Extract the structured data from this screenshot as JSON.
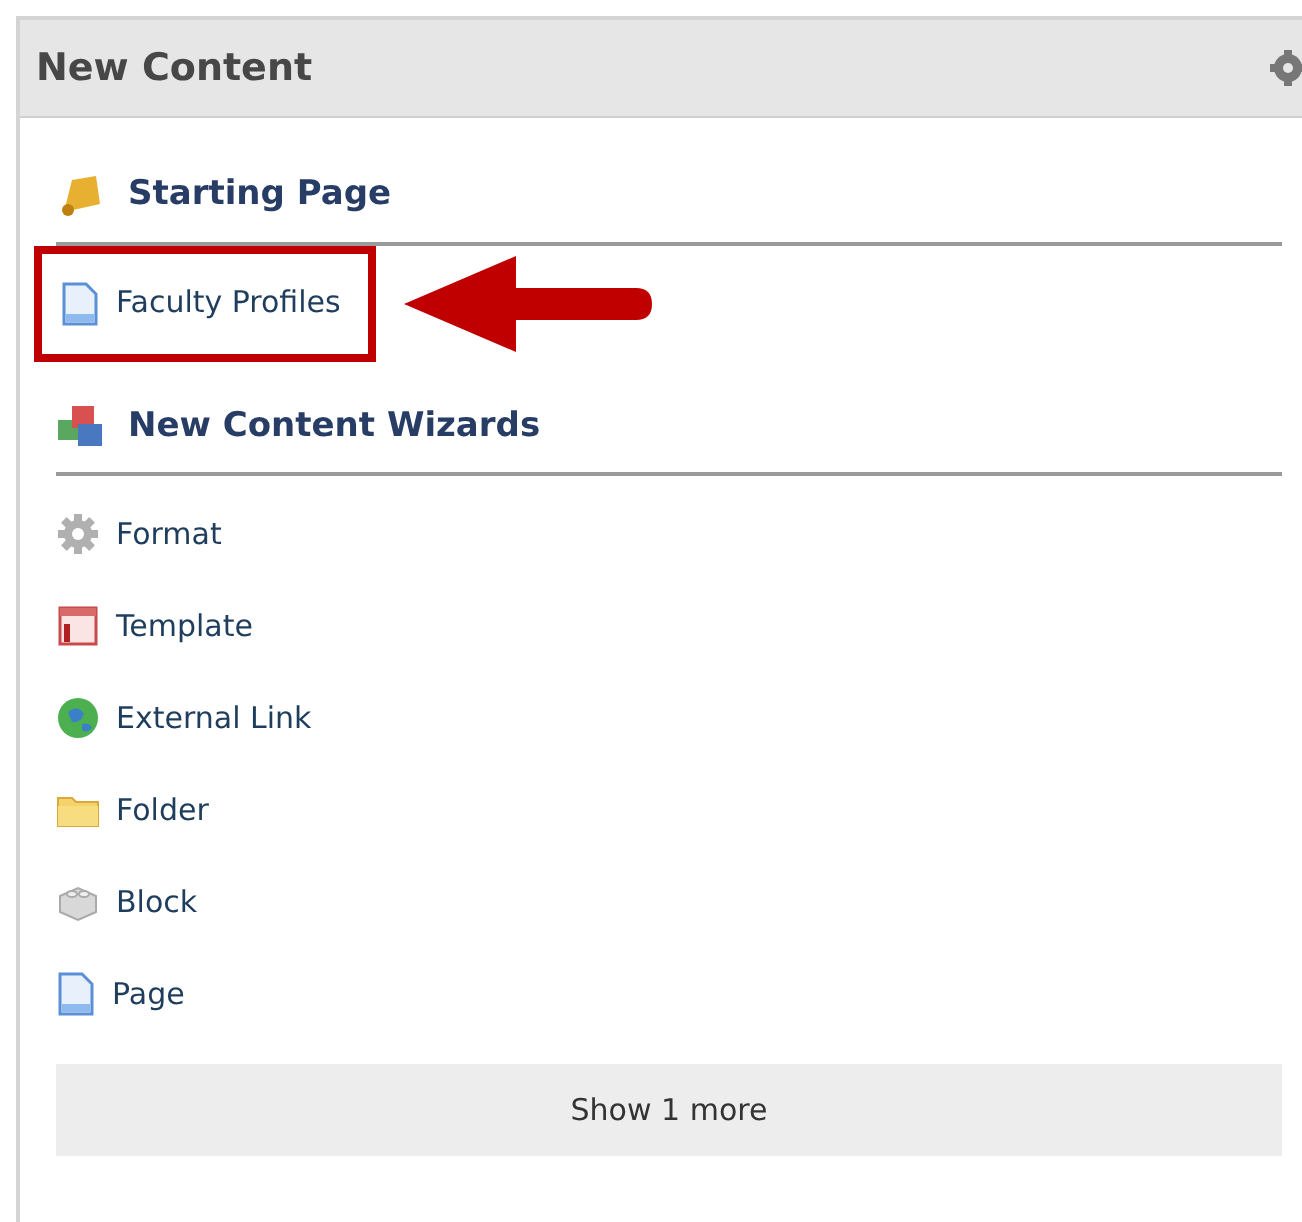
{
  "panel": {
    "title": "New Content"
  },
  "sections": [
    {
      "heading": "Starting Page",
      "kind": "starting",
      "items": [
        {
          "label": "Faculty Profiles",
          "kind": "page",
          "highlighted": true
        }
      ]
    },
    {
      "heading": "New Content Wizards",
      "kind": "wizards",
      "items": [
        {
          "label": "Format",
          "kind": "format",
          "highlighted": false
        },
        {
          "label": "Template",
          "kind": "template",
          "highlighted": false
        },
        {
          "label": "External Link",
          "kind": "link",
          "highlighted": false
        },
        {
          "label": "Folder",
          "kind": "folder",
          "highlighted": false
        },
        {
          "label": "Block",
          "kind": "block",
          "highlighted": false
        },
        {
          "label": "Page",
          "kind": "page",
          "highlighted": false
        }
      ]
    }
  ],
  "show_more": "Show 1 more"
}
